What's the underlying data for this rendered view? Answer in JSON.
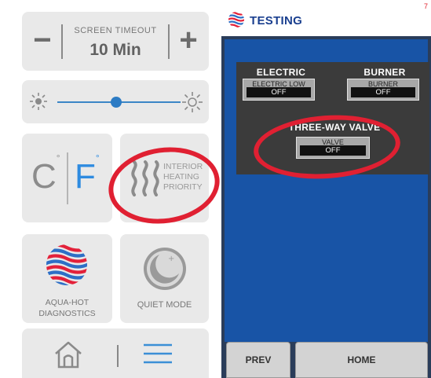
{
  "left_panel": {
    "screen_timeout": {
      "label": "SCREEN TIMEOUT",
      "value": "10 Min",
      "minus_label": "−",
      "plus_label": "+"
    },
    "brightness": {
      "level_percent": 48,
      "dim_icon": "sun-dim-icon",
      "bright_icon": "sun-bright-icon",
      "accent": "#2c7bc4"
    },
    "units": {
      "celsius": "C",
      "fahrenheit": "F",
      "degree": "°",
      "selected": "F",
      "selected_color": "#2e8be0"
    },
    "interior_heating": {
      "lines": [
        "INTERIOR",
        "HEATING",
        "PRIORITY"
      ],
      "icon": "heat-waves-icon"
    },
    "diagnostics": {
      "lines": [
        "AQUA-HOT",
        "DIAGNOSTICS"
      ],
      "icon": "aqua-hot-globe-icon"
    },
    "quiet_mode": {
      "label": "QUIET MODE",
      "icon": "moon-icon"
    },
    "nav": {
      "home_icon": "home-icon",
      "menu_icon": "menu-icon",
      "menu_color": "#3b8fd6"
    }
  },
  "right_panel": {
    "header": {
      "title": "TESTING",
      "page_number": "7"
    },
    "sections": {
      "electric": {
        "title": "ELECTRIC",
        "control_label": "ELECTRIC LOW",
        "value": "OFF"
      },
      "burner": {
        "title": "BURNER",
        "control_label": "BURNER",
        "value": "OFF"
      },
      "three_way_valve": {
        "title": "THREE-WAY VALVE",
        "control_label": "VALVE",
        "value": "OFF"
      }
    },
    "footer": {
      "prev_label": "PREV",
      "home_label": "HOME"
    },
    "colors": {
      "panel_blue": "#1854a6",
      "dark_box": "#3b3b3b",
      "frame": "#2a3d5a",
      "title_blue": "#1a3f8f"
    }
  },
  "highlight_color": "#e02032"
}
